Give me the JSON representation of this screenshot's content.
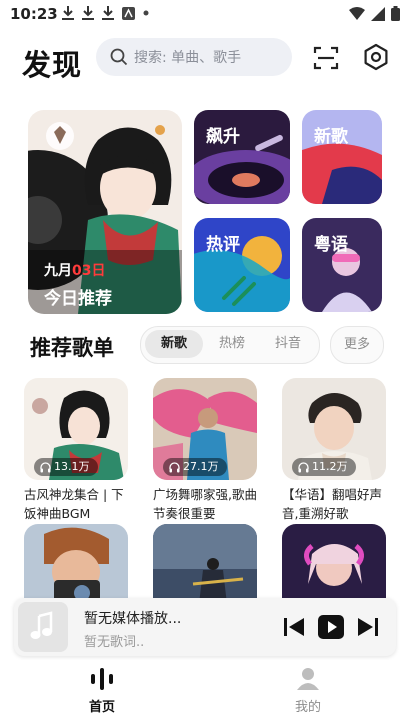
{
  "status": {
    "time": "10:23"
  },
  "header": {
    "title": "发现",
    "search_placeholder": "搜索: 单曲、歌手"
  },
  "feature": {
    "date_month": "九月",
    "date_day": "03日",
    "title": "今日推荐"
  },
  "tiles": [
    {
      "label": "飙升"
    },
    {
      "label": "新歌"
    },
    {
      "label": "热评"
    },
    {
      "label": "粤语"
    }
  ],
  "section": {
    "title": "推荐歌单",
    "tabs": [
      "新歌",
      "热榜",
      "抖音"
    ],
    "active_tab": "新歌",
    "more": "更多"
  },
  "playlists": [
    {
      "title": "古风神龙集合 | 下饭神曲BGM",
      "plays": "13.1万"
    },
    {
      "title": "广场舞哪家强,歌曲节奏很重要",
      "plays": "27.1万"
    },
    {
      "title": "【华语】翻唱好声音,重溯好歌",
      "plays": "11.2万"
    },
    {
      "title": "",
      "plays": ""
    },
    {
      "title": "",
      "plays": ""
    },
    {
      "title": "",
      "plays": ""
    }
  ],
  "player": {
    "title": "暂无媒体播放...",
    "subtitle": "暂无歌词.."
  },
  "nav": [
    {
      "label": "首页",
      "active": true
    },
    {
      "label": "我的",
      "active": false
    }
  ],
  "colors": {
    "accent": "#111111",
    "red": "#ff3b3b",
    "muted": "#8d8d8d"
  }
}
